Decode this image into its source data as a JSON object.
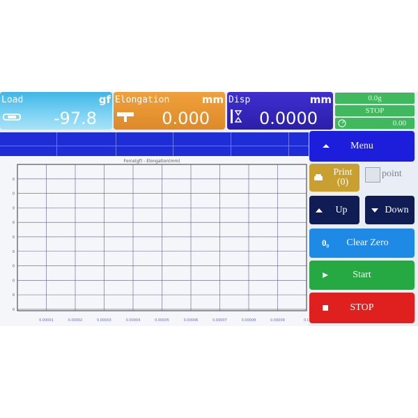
{
  "readouts": {
    "load": {
      "label": "Load",
      "unit": "gf",
      "value": "-97.8"
    },
    "elongation": {
      "label": "Elongation",
      "unit": "mm",
      "value": "0.000"
    },
    "disp": {
      "label": "Disp",
      "unit": "mm",
      "value": "0.0000"
    }
  },
  "status": {
    "top": "0.0g",
    "state": "STOP",
    "timer_value": "0.00"
  },
  "buttons": {
    "menu": "Menu",
    "print_line1": "Print",
    "print_line2": "(0)",
    "point": "point",
    "up": "Up",
    "down": "Down",
    "clear_zero": "Clear Zero",
    "clear_zero_icon_text": "0₀",
    "start": "Start",
    "stop": "STOP"
  },
  "chart_data": {
    "type": "line",
    "title": "Force(gf) - Elongation(mm)",
    "x_ticks": [
      "0.00001",
      "0.00002",
      "0.00003",
      "0.00004",
      "0.00005",
      "0.00006",
      "0.00007",
      "0.00008",
      "0.00009",
      "0.0"
    ],
    "y_ticks": [
      "0",
      "0",
      "0",
      "0",
      "0",
      "0",
      "0",
      "0",
      "0",
      "0"
    ],
    "series": [],
    "grid": true
  },
  "colors": {
    "menu": "#1d1ddc",
    "print": "#c9a030",
    "clear_zero": "#1e8ae6",
    "start": "#26a843",
    "stop": "#e01f1f",
    "table": "#1f2dd6"
  }
}
